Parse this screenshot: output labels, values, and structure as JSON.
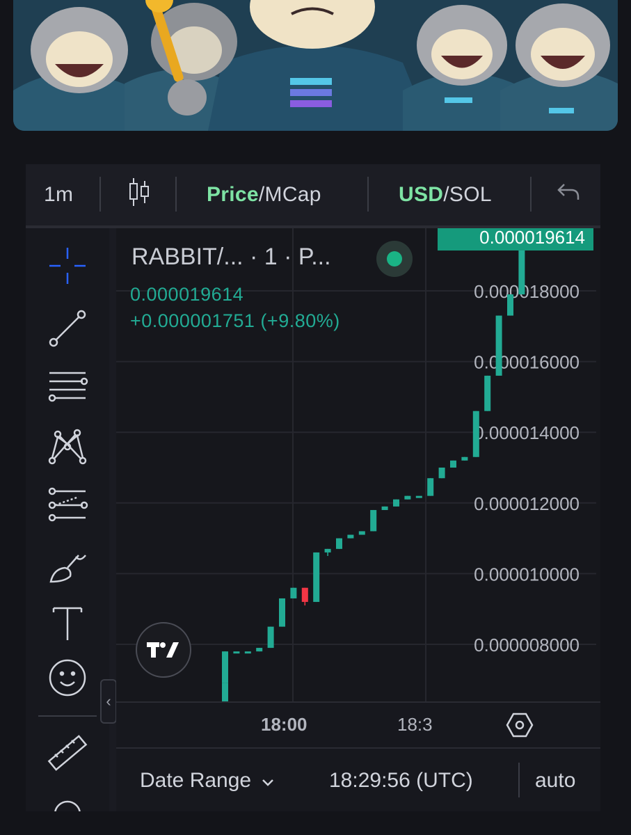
{
  "toolbar": {
    "interval": "1m",
    "price_label": "Price",
    "mcap_label": "/MCap",
    "usd_label": "USD",
    "sol_label": "/SOL",
    "undo_icon": "undo-icon",
    "candle_icon": "candlestick-icon"
  },
  "left_tools": [
    {
      "name": "crosshair-icon"
    },
    {
      "name": "trend-line-icon"
    },
    {
      "name": "horizontal-lines-icon"
    },
    {
      "name": "pattern-icon"
    },
    {
      "name": "fib-retracement-icon"
    },
    {
      "name": "brush-icon"
    },
    {
      "name": "text-icon"
    },
    {
      "name": "emoji-icon"
    },
    {
      "name": "ruler-icon"
    }
  ],
  "legend": {
    "symbol": "RABBIT/...",
    "meta": " · 1 · P...",
    "price": "0.000019614",
    "change": "+0.000001751 (+9.80%)"
  },
  "colors": {
    "up": "#22ab94",
    "down": "#f23645",
    "accent_green": "#7ee3a4",
    "price_tag": "#159a7c"
  },
  "chart_data": {
    "type": "candlestick",
    "current_price": "0.000019614",
    "y_ticks": [
      "0.000018000",
      "0.000016000",
      "0.000014000",
      "0.000012000",
      "0.000010000",
      "0.000008000"
    ],
    "y_tick_values": [
      1.8e-05,
      1.6e-05,
      1.4e-05,
      1.2e-05,
      1e-05,
      8e-06
    ],
    "x_ticks": [
      "18:00",
      "18:3"
    ],
    "candles": [
      {
        "o": 6.9e-06,
        "c": 7.8e-06,
        "h": 7.8e-06,
        "l": 6.9e-06
      },
      {
        "o": 7.8e-06,
        "c": 7.8e-06,
        "h": 7.8e-06,
        "l": 7.8e-06
      },
      {
        "o": 7.8e-06,
        "c": 7.8e-06,
        "h": 7.8e-06,
        "l": 7.8e-06
      },
      {
        "o": 7.8e-06,
        "c": 7.9e-06,
        "h": 7.9e-06,
        "l": 7.8e-06
      },
      {
        "o": 7.9e-06,
        "c": 8.5e-06,
        "h": 8.5e-06,
        "l": 7.9e-06
      },
      {
        "o": 8.5e-06,
        "c": 9.3e-06,
        "h": 9.3e-06,
        "l": 8.5e-06
      },
      {
        "o": 9.3e-06,
        "c": 9.6e-06,
        "h": 9.6e-06,
        "l": 9.3e-06
      },
      {
        "o": 9.6e-06,
        "c": 9.2e-06,
        "h": 9.6e-06,
        "l": 9.1e-06
      },
      {
        "o": 9.2e-06,
        "c": 1.06e-05,
        "h": 1.06e-05,
        "l": 9.2e-06
      },
      {
        "o": 1.06e-05,
        "c": 1.07e-05,
        "h": 1.07e-05,
        "l": 1.05e-05
      },
      {
        "o": 1.07e-05,
        "c": 1.1e-05,
        "h": 1.1e-05,
        "l": 1.07e-05
      },
      {
        "o": 1.1e-05,
        "c": 1.11e-05,
        "h": 1.11e-05,
        "l": 1.1e-05
      },
      {
        "o": 1.11e-05,
        "c": 1.12e-05,
        "h": 1.12e-05,
        "l": 1.11e-05
      },
      {
        "o": 1.12e-05,
        "c": 1.18e-05,
        "h": 1.18e-05,
        "l": 1.12e-05
      },
      {
        "o": 1.18e-05,
        "c": 1.19e-05,
        "h": 1.19e-05,
        "l": 1.18e-05
      },
      {
        "o": 1.19e-05,
        "c": 1.21e-05,
        "h": 1.21e-05,
        "l": 1.19e-05
      },
      {
        "o": 1.21e-05,
        "c": 1.22e-05,
        "h": 1.22e-05,
        "l": 1.21e-05
      },
      {
        "o": 1.22e-05,
        "c": 1.22e-05,
        "h": 1.22e-05,
        "l": 1.22e-05
      },
      {
        "o": 1.22e-05,
        "c": 1.27e-05,
        "h": 1.27e-05,
        "l": 1.22e-05
      },
      {
        "o": 1.27e-05,
        "c": 1.3e-05,
        "h": 1.3e-05,
        "l": 1.27e-05
      },
      {
        "o": 1.3e-05,
        "c": 1.32e-05,
        "h": 1.32e-05,
        "l": 1.3e-05
      },
      {
        "o": 1.32e-05,
        "c": 1.33e-05,
        "h": 1.33e-05,
        "l": 1.32e-05
      },
      {
        "o": 1.33e-05,
        "c": 1.46e-05,
        "h": 1.46e-05,
        "l": 1.33e-05
      },
      {
        "o": 1.46e-05,
        "c": 1.56e-05,
        "h": 1.56e-05,
        "l": 1.46e-05
      },
      {
        "o": 1.56e-05,
        "c": 1.73e-05,
        "h": 1.73e-05,
        "l": 1.56e-05
      },
      {
        "o": 1.73e-05,
        "c": 1.79e-05,
        "h": 1.79e-05,
        "l": 1.73e-05
      },
      {
        "o": 1.79e-05,
        "c": 1.9614e-05,
        "h": 1.98e-05,
        "l": 1.79e-05
      }
    ]
  },
  "time_axis": {
    "label_1": "18:00",
    "label_2": "18:3",
    "settings_icon": "settings-hexagon-icon"
  },
  "bottom_bar": {
    "date_range": "Date Range",
    "time": "18:29:56 (UTC)",
    "auto": "auto"
  }
}
